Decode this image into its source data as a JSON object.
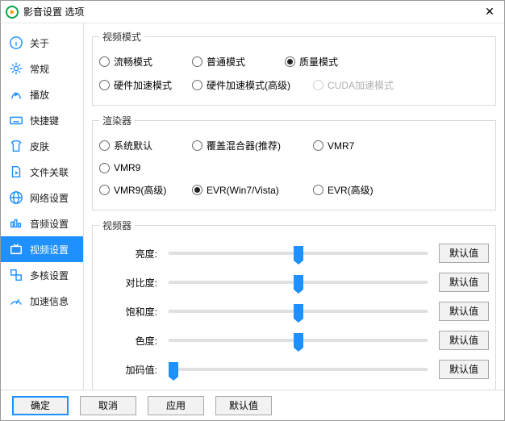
{
  "window": {
    "title": "影音设置 选项"
  },
  "sidebar": {
    "items": [
      {
        "label": "关于"
      },
      {
        "label": "常规"
      },
      {
        "label": "播放"
      },
      {
        "label": "快捷键"
      },
      {
        "label": "皮肤"
      },
      {
        "label": "文件关联"
      },
      {
        "label": "网络设置"
      },
      {
        "label": "音频设置"
      },
      {
        "label": "视频设置"
      },
      {
        "label": "多核设置"
      },
      {
        "label": "加速信息"
      }
    ],
    "active_index": 8
  },
  "groups": {
    "video_mode": {
      "legend": "视频模式",
      "row1": [
        {
          "label": "流畅模式",
          "checked": false
        },
        {
          "label": "普通模式",
          "checked": false
        },
        {
          "label": "质量模式",
          "checked": true
        }
      ],
      "row2": [
        {
          "label": "硬件加速模式",
          "checked": false
        },
        {
          "label": "硬件加速模式(高级)",
          "checked": false
        },
        {
          "label": "CUDA加速模式",
          "checked": false,
          "disabled": true
        }
      ]
    },
    "renderer": {
      "legend": "渲染器",
      "row1": [
        {
          "label": "系统默认",
          "checked": false
        },
        {
          "label": "覆盖混合器(推荐)",
          "checked": false
        },
        {
          "label": "VMR7",
          "checked": false
        },
        {
          "label": "VMR9",
          "checked": false
        }
      ],
      "row2": [
        {
          "label": "VMR9(高级)",
          "checked": false
        },
        {
          "label": "EVR(Win7/Vista)",
          "checked": true
        },
        {
          "label": "EVR(高级)",
          "checked": false
        }
      ]
    },
    "video_adj": {
      "legend": "视频器",
      "default_label": "默认值",
      "sliders": [
        {
          "label": "亮度:",
          "pos": 50
        },
        {
          "label": "对比度:",
          "pos": 50
        },
        {
          "label": "饱和度:",
          "pos": 50
        },
        {
          "label": "色度:",
          "pos": 50
        },
        {
          "label": "加码值:",
          "pos": 2
        }
      ]
    }
  },
  "buttons": {
    "ok": "确定",
    "cancel": "取消",
    "apply": "应用",
    "defaults": "默认值"
  }
}
